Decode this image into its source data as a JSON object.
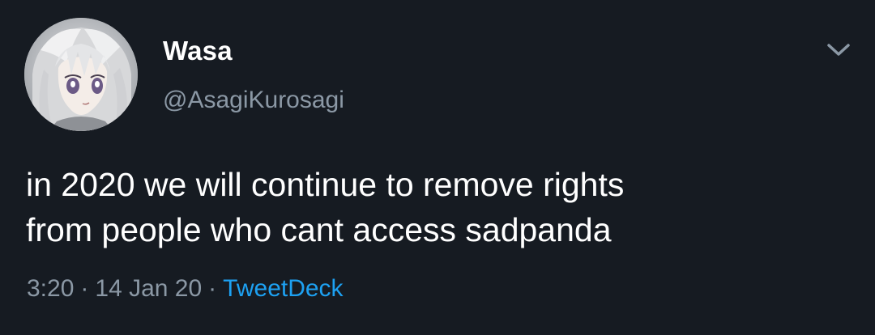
{
  "tweet": {
    "author": {
      "display_name": "Wasa",
      "handle": "@AsagiKurosagi",
      "avatar_icon": "anime-avatar-image"
    },
    "text_lines": [
      "in 2020 we will continue to remove rights",
      "from people who cant access sadpanda"
    ],
    "meta": {
      "time": "3:20",
      "separator": "·",
      "date": "14 Jan 20",
      "source": "TweetDeck"
    },
    "menu_icon": "chevron-down-icon"
  },
  "colors": {
    "background": "#161b22",
    "primary_text": "#ffffff",
    "secondary_text": "#8b98a5",
    "link": "#1da1f2"
  }
}
